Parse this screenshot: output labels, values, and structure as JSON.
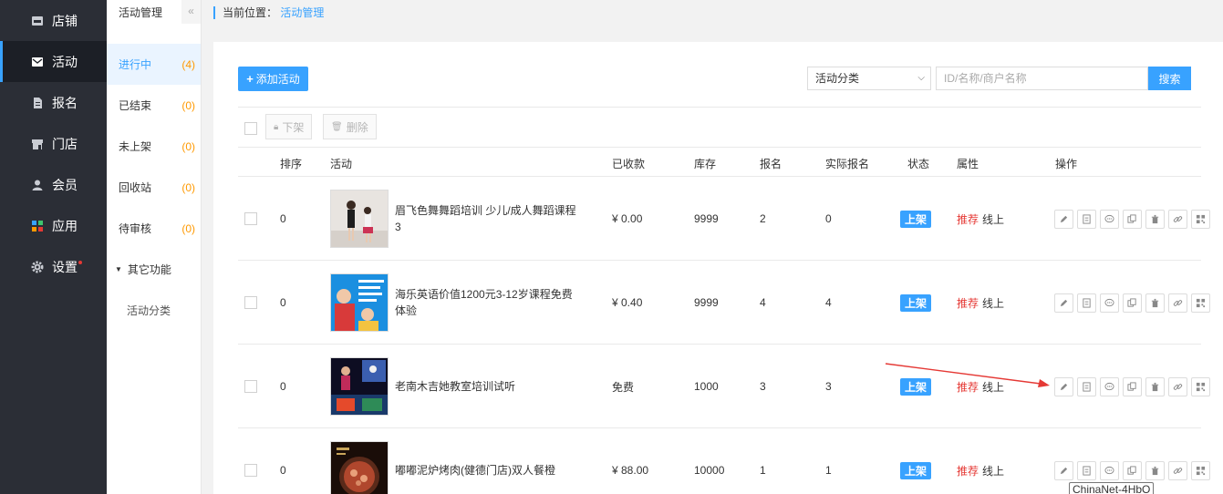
{
  "nav": {
    "items": [
      {
        "label": "店铺",
        "icon": "store-icon"
      },
      {
        "label": "活动",
        "icon": "envelope-icon",
        "active": true
      },
      {
        "label": "报名",
        "icon": "document-icon"
      },
      {
        "label": "门店",
        "icon": "shop-icon"
      },
      {
        "label": "会员",
        "icon": "user-icon"
      },
      {
        "label": "应用",
        "icon": "apps-icon"
      },
      {
        "label": "设置",
        "icon": "gear-icon",
        "dot": true
      }
    ]
  },
  "subnav": {
    "title": "活动管理",
    "collapse": "«",
    "items": [
      {
        "label": "进行中",
        "count": "(4)",
        "active": true
      },
      {
        "label": "已结束",
        "count": "(0)"
      },
      {
        "label": "未上架",
        "count": "(0)"
      },
      {
        "label": "回收站",
        "count": "(0)"
      },
      {
        "label": "待审核",
        "count": "(0)"
      }
    ],
    "group": {
      "label": "其它功能",
      "children": [
        "活动分类"
      ]
    }
  },
  "breadcrumb": {
    "prefix": "当前位置：",
    "current": "活动管理"
  },
  "toolbar": {
    "add_label": "添加活动",
    "category_select": "活动分类",
    "search_placeholder": "ID/名称/商户名称",
    "search_label": "搜索",
    "offshelf_label": "下架",
    "delete_label": "删除"
  },
  "table": {
    "headers": {
      "sort": "排序",
      "activity": "活动",
      "received": "已收款",
      "stock": "库存",
      "signup": "报名",
      "actual": "实际报名",
      "status": "状态",
      "attr": "属性",
      "ops": "操作"
    },
    "rows": [
      {
        "sort": "0",
        "title": "眉飞色舞舞蹈培训 少儿/成人舞蹈课程3",
        "received": "¥ 0.00",
        "stock": "9999",
        "signup": "2",
        "actual": "0",
        "status": "上架",
        "attr_tag": "推荐",
        "attr_mode": "线上"
      },
      {
        "sort": "0",
        "title": "海乐英语价值1200元3-12岁课程免费体验",
        "received": "¥ 0.40",
        "stock": "9999",
        "signup": "4",
        "actual": "4",
        "status": "上架",
        "attr_tag": "推荐",
        "attr_mode": "线上"
      },
      {
        "sort": "0",
        "title": "老南木吉她教室培训试听",
        "received": "免费",
        "stock": "1000",
        "signup": "3",
        "actual": "3",
        "status": "上架",
        "attr_tag": "推荐",
        "attr_mode": "线上"
      },
      {
        "sort": "0",
        "title": "嘟嘟泥炉烤肉(健德门店)双人餐橙",
        "received": "¥ 88.00",
        "stock": "10000",
        "signup": "1",
        "actual": "1",
        "status": "上架",
        "attr_tag": "推荐",
        "attr_mode": "线上"
      }
    ],
    "op_icons": [
      "edit-icon",
      "list-icon",
      "comment-icon",
      "copy-icon",
      "trash-icon",
      "link-icon",
      "qrcode-icon"
    ]
  },
  "tooltip": "ChinaNet-4HbO",
  "colors": {
    "accent": "#38a2ff",
    "nav_bg": "#2b2e36",
    "count": "#ff9900",
    "tag": "#e53935"
  }
}
